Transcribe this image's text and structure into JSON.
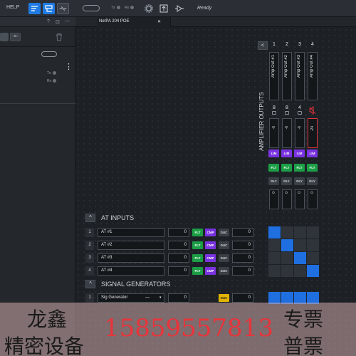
{
  "toolbar": {
    "help": "HELP",
    "tx": "Tx",
    "rx": "Rx",
    "status": "Ready"
  },
  "left_panel": {
    "tx": "Tx",
    "rx": "Rx"
  },
  "tab": {
    "label": "NetPA 204 POE",
    "close": "✕"
  },
  "outputs": {
    "section_title": "AMPLIFIER OUTPUTS",
    "back": "<",
    "channels": [
      {
        "number": "1",
        "name": "Amp Out #1",
        "load": "8",
        "gain": "-6",
        "lim": "LIM",
        "flt": "FLT",
        "dly": "DLY",
        "delay": "0"
      },
      {
        "number": "2",
        "name": "Amp Out #2",
        "load": "8",
        "gain": "-6",
        "lim": "LIM",
        "flt": "FLT",
        "dly": "DLY",
        "delay": "0"
      },
      {
        "number": "3",
        "name": "Amp Out #3",
        "load": "4",
        "gain": "-6",
        "lim": "LIM",
        "flt": "FLT",
        "dly": "DLY",
        "delay": "0"
      },
      {
        "number": "4",
        "name": "Amp Out #4",
        "load": "",
        "gain": "-24",
        "lim": "LIM",
        "flt": "FLT",
        "dly": "DLY",
        "delay": "0"
      }
    ]
  },
  "inputs": {
    "section_title": "AT INPUTS",
    "rows": [
      {
        "number": "1",
        "name": "AT #1",
        "gain": "0",
        "flt": "FLT",
        "cmp": "CMP",
        "duc": "DUC",
        "value": "0",
        "routes": [
          1,
          0,
          0,
          0
        ]
      },
      {
        "number": "2",
        "name": "AT #2",
        "gain": "0",
        "flt": "FLT",
        "cmp": "CMP",
        "duc": "DUC",
        "value": "0",
        "routes": [
          0,
          1,
          0,
          0
        ]
      },
      {
        "number": "3",
        "name": "AT #3",
        "gain": "0",
        "flt": "FLT",
        "cmp": "CMP",
        "duc": "DUC",
        "value": "0",
        "routes": [
          0,
          0,
          1,
          0
        ]
      },
      {
        "number": "4",
        "name": "AT #4",
        "gain": "0",
        "flt": "FLT",
        "cmp": "CMP",
        "duc": "DUC",
        "value": "0",
        "routes": [
          0,
          0,
          0,
          1
        ]
      }
    ]
  },
  "generators": {
    "section_title": "SIGNAL GENERATORS",
    "rows": [
      {
        "number": "1",
        "name": "Sig Generator",
        "mode": "—",
        "gain": "0",
        "duc": "DUC",
        "value": "0",
        "routes": [
          1,
          1,
          1,
          1
        ]
      }
    ]
  },
  "watermark": {
    "line1_left": "龙鑫",
    "line1_right": "专票",
    "line2_left": "精密设备",
    "phone": "15859557813",
    "line2_right": "普票"
  },
  "colors": {
    "accent": "#1f7be3",
    "lim": "#7a33e0",
    "flt": "#1b9e45",
    "duc_active": "#e2b400",
    "mute": "#e0343a"
  }
}
